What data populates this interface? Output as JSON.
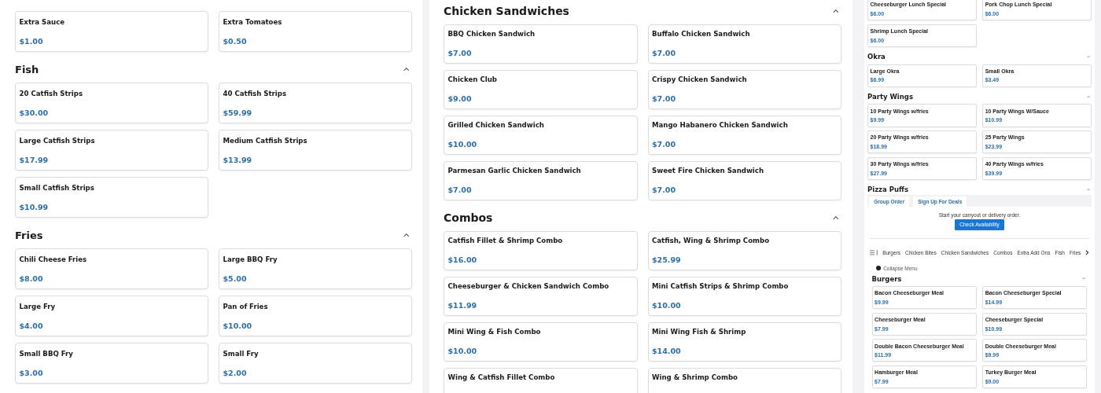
{
  "panels": [
    {
      "blocks": [
        {
          "kind": "cards",
          "items": [
            {
              "name": "Extra Sauce",
              "price": "$1.00"
            },
            {
              "name": "Extra Tomatoes",
              "price": "$0.50"
            }
          ]
        },
        {
          "kind": "section",
          "title": "Fish",
          "expanded": true
        },
        {
          "kind": "cards",
          "items": [
            {
              "name": "20 Catfish Strips",
              "price": "$30.00"
            },
            {
              "name": "40 Catfish Strips",
              "price": "$59.99"
            },
            {
              "name": "Large Catfish Strips",
              "price": "$17.99"
            },
            {
              "name": "Medium Catfish Strips",
              "price": "$13.99"
            },
            {
              "name": "Small Catfish Strips",
              "price": "$10.99"
            }
          ]
        },
        {
          "kind": "section",
          "title": "Fries",
          "expanded": true
        },
        {
          "kind": "cards",
          "items": [
            {
              "name": "Chili Cheese Fries",
              "price": "$8.00"
            },
            {
              "name": "Large BBQ Fry",
              "price": "$5.00"
            },
            {
              "name": "Large Fry",
              "price": "$4.00"
            },
            {
              "name": "Pan of Fries",
              "price": "$10.00"
            },
            {
              "name": "Small BBQ Fry",
              "price": "$3.00"
            },
            {
              "name": "Small Fry",
              "price": "$2.00"
            }
          ]
        }
      ]
    },
    {
      "blocks": [
        {
          "kind": "section",
          "title": "Chicken Sandwiches",
          "expanded": true
        },
        {
          "kind": "cards",
          "items": [
            {
              "name": "BBQ Chicken Sandwich",
              "price": "$7.00"
            },
            {
              "name": "Buffalo Chicken Sandwich",
              "price": "$7.00"
            },
            {
              "name": "Chicken Club",
              "price": "$9.00"
            },
            {
              "name": "Crispy Chicken Sandwich",
              "price": "$7.00"
            },
            {
              "name": "Grilled Chicken Sandwich",
              "price": "$10.00"
            },
            {
              "name": "Mango Habanero Chicken Sandwich",
              "price": "$7.00"
            },
            {
              "name": "Parmesan Garlic Chicken Sandwich",
              "price": "$7.00"
            },
            {
              "name": "Sweet Fire Chicken Sandwich",
              "price": "$7.00"
            }
          ]
        },
        {
          "kind": "section",
          "title": "Combos",
          "expanded": true
        },
        {
          "kind": "cards",
          "items": [
            {
              "name": "Catfish Fillet & Shrimp Combo",
              "price": "$16.00"
            },
            {
              "name": "Catfish, Wing & Shrimp Combo",
              "price": "$25.99"
            },
            {
              "name": "Cheeseburger & Chicken Sandwich Combo",
              "price": "$11.99"
            },
            {
              "name": "Mini Catfish Strips & Shrimp Combo",
              "price": "$10.00"
            },
            {
              "name": "Mini Wing & Fish Combo",
              "price": "$10.00"
            },
            {
              "name": "Mini Wing Fish & Shrimp",
              "price": "$14.00"
            },
            {
              "name": "Wing & Catfish Fillet Combo"
            },
            {
              "name": "Wing & Shrimp Combo"
            }
          ]
        }
      ]
    },
    {
      "blocks": [
        {
          "kind": "cards",
          "items": [
            {
              "name": "Cheeseburger Lunch Special",
              "price": "$6.00"
            },
            {
              "name": "Pork Chop Lunch Special",
              "price": "$6.00"
            },
            {
              "name": "Shrimp Lunch Special",
              "price": "$6.00"
            }
          ]
        },
        {
          "kind": "section",
          "title": "Okra",
          "expanded": true
        },
        {
          "kind": "cards",
          "items": [
            {
              "name": "Large Okra",
              "price": "$6.99"
            },
            {
              "name": "Small Okra",
              "price": "$3.49"
            }
          ]
        },
        {
          "kind": "section",
          "title": "Party Wings",
          "expanded": true
        },
        {
          "kind": "cards",
          "items": [
            {
              "name": "10 Party Wings w/fries",
              "price": "$9.99"
            },
            {
              "name": "10 Party Wings W/Sauce",
              "price": "$10.99"
            },
            {
              "name": "20 Party Wings w/fries",
              "price": "$18.99"
            },
            {
              "name": "25 Party Wings",
              "price": "$23.99"
            },
            {
              "name": "30 Party Wings w/fries",
              "price": "$27.99"
            },
            {
              "name": "40 Party Wings w/fries",
              "price": "$39.99"
            }
          ]
        },
        {
          "kind": "section",
          "title": "Pizza Puffs",
          "expanded": true
        },
        {
          "kind": "embedded_page",
          "tabs": [
            {
              "label": "Group Order"
            },
            {
              "label": "Sign Up For Deals"
            }
          ],
          "prompt": "Start your carryout or delivery order.",
          "button": "Check Availability",
          "categories": [
            "Burgers",
            "Chicken Bites",
            "Chicken Sandwiches",
            "Combos",
            "Extra Add Ons",
            "Fish",
            "Fries"
          ],
          "collapse": "Collapse Menu",
          "blocks": [
            {
              "kind": "section",
              "title": "Burgers",
              "expanded": true
            },
            {
              "kind": "cards",
              "items": [
                {
                  "name": "Bacon Cheeseburger Meal",
                  "price": "$9.99"
                },
                {
                  "name": "Bacon Cheeseburger Special",
                  "price": "$14.99"
                },
                {
                  "name": "Cheeseburger Meal",
                  "price": "$7.99"
                },
                {
                  "name": "Cheeseburger Special",
                  "price": "$10.99"
                },
                {
                  "name": "Double Bacon Cheeseburger Meal",
                  "price": "$11.99"
                },
                {
                  "name": "Double Cheeseburger Meal",
                  "price": "$9.99"
                },
                {
                  "name": "Hamburger Meal",
                  "price": "$7.99"
                },
                {
                  "name": "Turkey Burger Meal",
                  "price": "$9.00"
                }
              ]
            }
          ]
        }
      ]
    }
  ]
}
